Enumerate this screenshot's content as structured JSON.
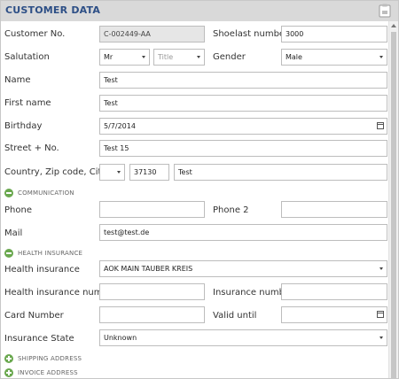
{
  "header": {
    "title": "CUSTOMER DATA",
    "icon": "clipboard-icon"
  },
  "labels": {
    "customer_no": "Customer No.",
    "shoelast_number": "Shoelast number",
    "salutation": "Salutation",
    "gender": "Gender",
    "name": "Name",
    "first_name": "First name",
    "birthday": "Birthday",
    "street": "Street + No.",
    "country_zip_city": "Country, Zip code, City",
    "phone": "Phone",
    "phone2": "Phone 2",
    "mail": "Mail",
    "health_insurance": "Health insurance",
    "health_insurance_number": "Health insurance number",
    "insurance_number": "Insurance number",
    "card_number": "Card Number",
    "valid_until": "Valid until",
    "insurance_state": "Insurance State"
  },
  "values": {
    "customer_no": "C-002449-AA",
    "shoelast_number": "3000",
    "salutation": "Mr",
    "title_placeholder": "Title",
    "gender": "Male",
    "name": "Test",
    "first_name": "Test",
    "birthday": "5/7/2014",
    "street": "Test 15",
    "country": "",
    "zip_code": "37130",
    "city": "Test",
    "phone": "",
    "phone2": "",
    "mail": "test@test.de",
    "health_insurance": "AOK MAIN TAUBER KREIS",
    "health_insurance_number": "",
    "insurance_number": "",
    "card_number": "",
    "valid_until": "",
    "insurance_state": "Unknown"
  },
  "sections": {
    "communication": "COMMUNICATION",
    "health_insurance": "HEALTH INSURANCE",
    "shipping_address": "SHIPPING ADDRESS",
    "invoice_address": "INVOICE ADDRESS"
  },
  "colors": {
    "header_text": "#2d4f86",
    "header_bg": "#d9d9d9",
    "section_icon": "#6aa84f"
  }
}
